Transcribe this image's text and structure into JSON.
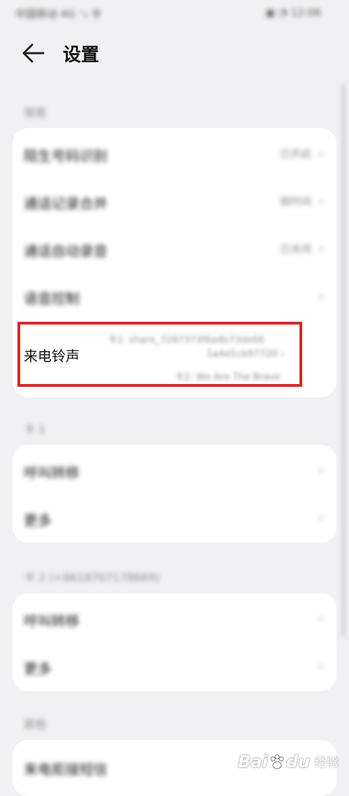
{
  "status_bar": {
    "left": "中国移动 4G ⁺ᵢₗ 令",
    "right": "▣ ◔ 12:06"
  },
  "header": {
    "title": "设置"
  },
  "sections": {
    "general": {
      "label": "常用",
      "rows": [
        {
          "label": "陌生号码识别",
          "value": "已开启"
        },
        {
          "label": "通话记录合并",
          "value": "按时间"
        },
        {
          "label": "通话自动录音",
          "value": "已关闭"
        },
        {
          "label": "语音控制",
          "value": ""
        }
      ]
    },
    "ringtone": {
      "label": "来电铃声",
      "sim1": "卡1: share_7287373f6a4b73de66",
      "sim1_cont": "1a4d1cb97720 ›",
      "sim2": "卡2: We Are The Brave"
    },
    "sim1": {
      "label": "卡 1",
      "rows": [
        {
          "label": "呼叫转移"
        },
        {
          "label": "更多"
        }
      ]
    },
    "sim2": {
      "label": "卡 2 (+8618707178669)",
      "rows": [
        {
          "label": "呼叫转移"
        },
        {
          "label": "更多"
        }
      ]
    },
    "other": {
      "label": "其他",
      "rows": [
        {
          "label": "来电拒接短信"
        }
      ]
    }
  },
  "watermark": {
    "logo": "Bai",
    "logo2": "du",
    "text": "经验"
  }
}
